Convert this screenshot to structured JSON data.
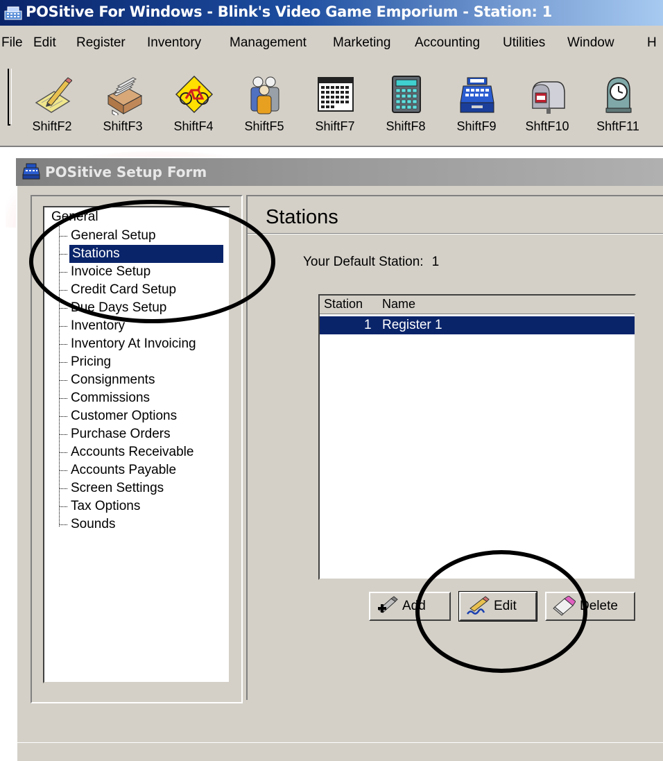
{
  "window": {
    "title": "POSitive For Windows - Blink's Video Game Emporium - Station: 1"
  },
  "menubar": [
    {
      "label": "File"
    },
    {
      "label": "Edit"
    },
    {
      "label": "Register"
    },
    {
      "label": "Inventory"
    },
    {
      "label": "Management"
    },
    {
      "label": "Marketing"
    },
    {
      "label": "Accounting"
    },
    {
      "label": "Utilities"
    },
    {
      "label": "Window"
    },
    {
      "label": "H"
    }
  ],
  "toolbar": [
    {
      "label": "ShiftF2",
      "icon": "notepad-pencil-icon"
    },
    {
      "label": "ShiftF3",
      "icon": "card-box-icon"
    },
    {
      "label": "ShiftF4",
      "icon": "bicycle-icon"
    },
    {
      "label": "ShiftF5",
      "icon": "people-icon"
    },
    {
      "label": "ShiftF7",
      "icon": "calendar-icon"
    },
    {
      "label": "ShiftF8",
      "icon": "calculator-icon"
    },
    {
      "label": "ShiftF9",
      "icon": "cash-register-icon"
    },
    {
      "label": "ShftF10",
      "icon": "mailbox-icon"
    },
    {
      "label": "ShftF11",
      "icon": "clock-icon"
    }
  ],
  "form": {
    "title": "POSitive Setup Form"
  },
  "tree": {
    "root": "General",
    "items": [
      {
        "label": "General Setup",
        "selected": false
      },
      {
        "label": "Stations",
        "selected": true
      },
      {
        "label": "Invoice Setup",
        "selected": false
      },
      {
        "label": "Credit Card Setup",
        "selected": false
      },
      {
        "label": "Due Days Setup",
        "selected": false
      },
      {
        "label": "Inventory",
        "selected": false
      },
      {
        "label": "Inventory At Invoicing",
        "selected": false
      },
      {
        "label": "Pricing",
        "selected": false
      },
      {
        "label": "Consignments",
        "selected": false
      },
      {
        "label": "Commissions",
        "selected": false
      },
      {
        "label": "Customer Options",
        "selected": false
      },
      {
        "label": "Purchase Orders",
        "selected": false
      },
      {
        "label": "Accounts Receivable",
        "selected": false
      },
      {
        "label": "Accounts Payable",
        "selected": false
      },
      {
        "label": "Screen Settings",
        "selected": false
      },
      {
        "label": "Tax Options",
        "selected": false
      },
      {
        "label": "Sounds",
        "selected": false
      }
    ]
  },
  "stations": {
    "heading": "Stations",
    "default_label": "Your Default Station:",
    "default_value": "1",
    "columns": [
      "Station",
      "Name"
    ],
    "rows": [
      {
        "station": "1",
        "name": "Register 1",
        "selected": true
      }
    ],
    "buttons": {
      "add": "Add",
      "edit": "Edit",
      "delete": "Delete"
    }
  },
  "colors": {
    "titlebar": "#0a246a",
    "selection": "#0a246a",
    "face": "#d4d0c8",
    "annotation": "#000000"
  }
}
